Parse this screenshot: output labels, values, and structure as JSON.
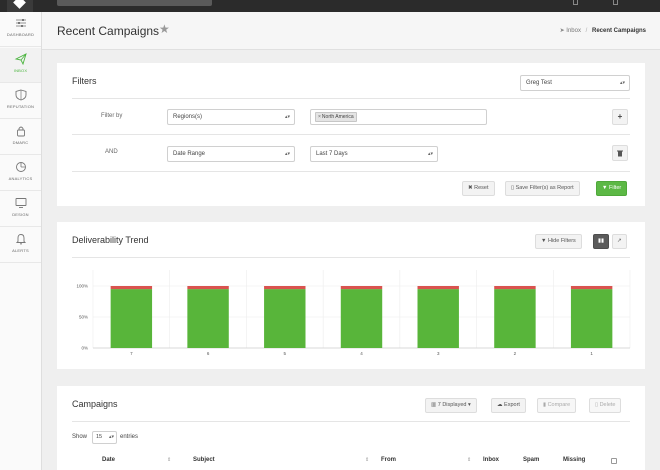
{
  "sidebar": {
    "items": [
      {
        "label": "DASHBOARD",
        "icon": "sliders-icon"
      },
      {
        "label": "INBOX",
        "icon": "paper-plane-icon"
      },
      {
        "label": "REPUTATION",
        "icon": "shield-icon"
      },
      {
        "label": "DMARC",
        "icon": "lock-icon"
      },
      {
        "label": "ANALYTICS",
        "icon": "pie-chart-icon"
      },
      {
        "label": "DESIGN",
        "icon": "monitor-icon"
      },
      {
        "label": "ALERTS",
        "icon": "bell-icon"
      }
    ],
    "active": "INBOX",
    "accent": "#4ab43e"
  },
  "header": {
    "title": "Recent Campaigns",
    "breadcrumb": {
      "link": "Inbox",
      "current": "Recent Campaigns"
    }
  },
  "filters": {
    "title": "Filters",
    "account_select": "Greg Test",
    "row1": {
      "label": "Filter by",
      "field": "Regions(s)",
      "tag": "North America",
      "tag_remove": "×"
    },
    "row2": {
      "label": "AND",
      "field": "Date Range",
      "value": "Last 7 Days"
    },
    "buttons": {
      "reset": "Reset",
      "save": "Save Filter(s) as Report",
      "filter": "Filter"
    }
  },
  "trend": {
    "title": "Deliverability Trend",
    "hide_filters": "Hide Filters"
  },
  "chart_data": {
    "type": "bar",
    "stacked": true,
    "categories": [
      "7",
      "6",
      "5",
      "4",
      "3",
      "2",
      "1"
    ],
    "series": [
      {
        "color": "#58b53a",
        "values": [
          95,
          95,
          95,
          95,
          95,
          95,
          95
        ]
      },
      {
        "color": "#d9534f",
        "values": [
          5,
          5,
          5,
          5,
          5,
          5,
          5
        ]
      }
    ],
    "yticks": [
      "100%",
      "50%",
      "0%"
    ],
    "ylim": [
      0,
      100
    ],
    "grid": true
  },
  "campaigns": {
    "title": "Campaigns",
    "displayed": "7 Displayed",
    "export": "Export",
    "compare": "Compare",
    "delete": "Delete",
    "show_label": "Show",
    "page_size": "15",
    "entries_label": "entries",
    "columns": [
      "Date",
      "Subject",
      "From",
      "Inbox",
      "Spam",
      "Missing"
    ]
  }
}
